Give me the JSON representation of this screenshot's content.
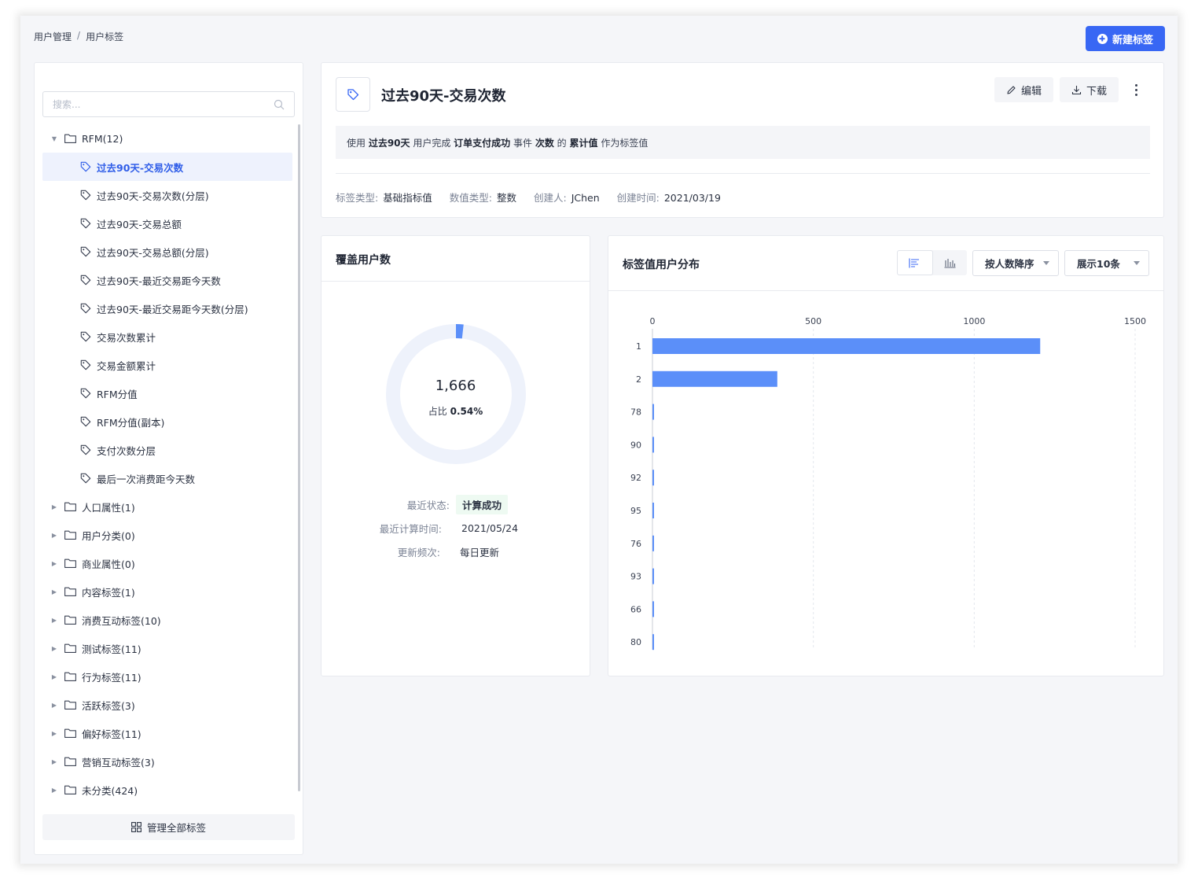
{
  "breadcrumb": {
    "root": "用户管理",
    "sep": "/",
    "current": "用户标签"
  },
  "new_tag_button": "新建标签",
  "sidebar": {
    "search_placeholder": "搜索...",
    "tree": [
      {
        "label": "RFM(12)",
        "type": "folder",
        "expanded": true
      },
      {
        "label": "过去90天-交易次数",
        "type": "leaf",
        "active": true
      },
      {
        "label": "过去90天-交易次数(分层)",
        "type": "leaf"
      },
      {
        "label": "过去90天-交易总额",
        "type": "leaf"
      },
      {
        "label": "过去90天-交易总额(分层)",
        "type": "leaf"
      },
      {
        "label": "过去90天-最近交易距今天数",
        "type": "leaf"
      },
      {
        "label": "过去90天-最近交易距今天数(分层)",
        "type": "leaf"
      },
      {
        "label": "交易次数累计",
        "type": "leaf"
      },
      {
        "label": "交易金额累计",
        "type": "leaf"
      },
      {
        "label": "RFM分值",
        "type": "leaf"
      },
      {
        "label": "RFM分值(副本)",
        "type": "leaf"
      },
      {
        "label": "支付次数分层",
        "type": "leaf"
      },
      {
        "label": "最后一次消费距今天数",
        "type": "leaf"
      },
      {
        "label": "人口属性(1)",
        "type": "folder"
      },
      {
        "label": "用户分类(0)",
        "type": "folder"
      },
      {
        "label": "商业属性(0)",
        "type": "folder"
      },
      {
        "label": "内容标签(1)",
        "type": "folder"
      },
      {
        "label": "消费互动标签(10)",
        "type": "folder"
      },
      {
        "label": "测试标签(11)",
        "type": "folder"
      },
      {
        "label": "行为标签(11)",
        "type": "folder"
      },
      {
        "label": "活跃标签(3)",
        "type": "folder"
      },
      {
        "label": "偏好标签(11)",
        "type": "folder"
      },
      {
        "label": "营销互动标签(3)",
        "type": "folder"
      },
      {
        "label": "未分类(424)",
        "type": "folder"
      }
    ],
    "manage_button": "管理全部标签"
  },
  "header": {
    "title": "过去90天-交易次数",
    "edit_label": "编辑",
    "download_label": "下载",
    "description_parts": [
      {
        "text": "使用 ",
        "bold": false
      },
      {
        "text": "过去90天",
        "bold": true
      },
      {
        "text": " 用户完成 ",
        "bold": false
      },
      {
        "text": "订单支付成功",
        "bold": true
      },
      {
        "text": " 事件 ",
        "bold": false
      },
      {
        "text": "次数",
        "bold": true
      },
      {
        "text": " 的 ",
        "bold": false
      },
      {
        "text": "累计值",
        "bold": true
      },
      {
        "text": " 作为标签值",
        "bold": false
      }
    ],
    "meta": [
      {
        "key": "标签类型:",
        "value": "基础指标值"
      },
      {
        "key": "数值类型:",
        "value": "整数"
      },
      {
        "key": "创建人:",
        "value": "JChen"
      },
      {
        "key": "创建时间:",
        "value": "2021/03/19"
      }
    ]
  },
  "coverage": {
    "title": "覆盖用户数",
    "count": "1,666",
    "ratio_label": "占比",
    "ratio_value": "0.54%",
    "ratio_fraction": 0.0054,
    "status_key": "最近状态:",
    "status_value": "计算成功",
    "calc_time_key": "最近计算时间:",
    "calc_time_value": "2021/05/24",
    "freq_key": "更新频次:",
    "freq_value": "每日更新"
  },
  "distribution": {
    "title": "标签值用户分布",
    "sort_select": "按人数降序",
    "count_select": "展示10条"
  },
  "colors": {
    "accent": "#3867f4",
    "bar": "#5b8ff9",
    "success": "#2db860"
  },
  "chart_data": {
    "type": "bar",
    "orientation": "horizontal",
    "categories": [
      "1",
      "2",
      "78",
      "90",
      "92",
      "95",
      "76",
      "93",
      "66",
      "80"
    ],
    "values": [
      1205,
      388,
      4,
      4,
      3,
      3,
      3,
      3,
      3,
      3
    ],
    "xlim": [
      0,
      1500
    ],
    "xticks": [
      0,
      500,
      1000,
      1500
    ],
    "grid": true
  }
}
